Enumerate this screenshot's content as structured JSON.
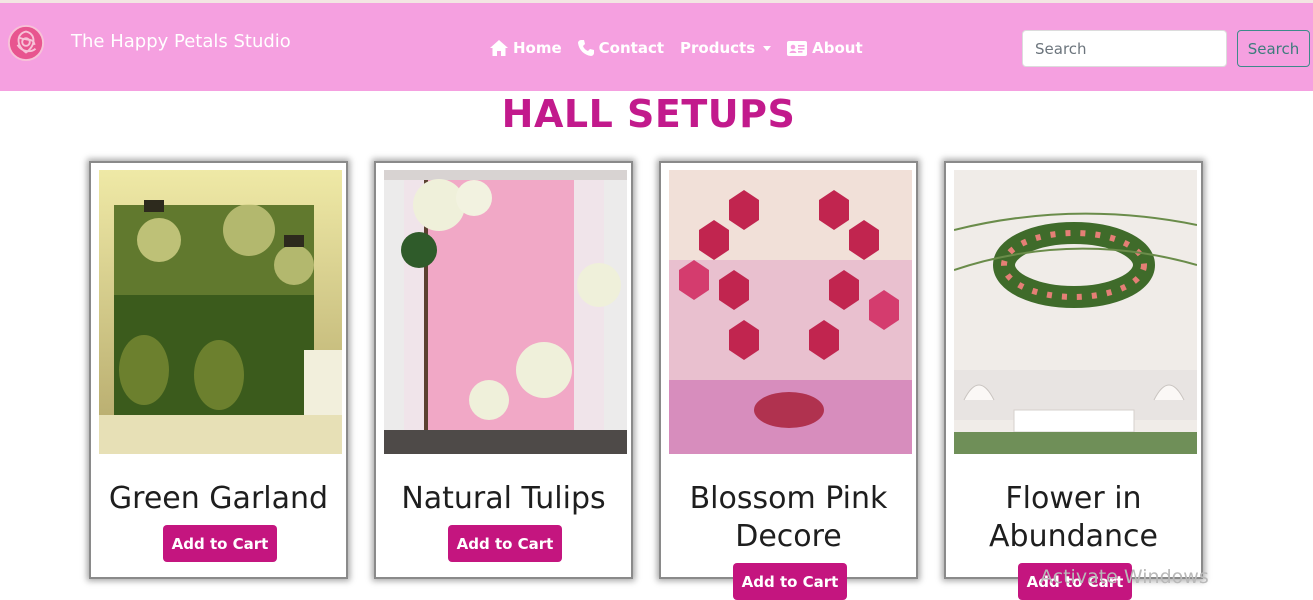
{
  "brand": {
    "name": "The Happy Petals Studio"
  },
  "nav": {
    "home": "Home",
    "contact": "Contact",
    "products": "Products",
    "about": "About"
  },
  "search": {
    "placeholder": "Search",
    "button": "Search"
  },
  "page": {
    "title": "HALL SETUPS"
  },
  "products": [
    {
      "name": "Green Garland",
      "button": "Add to Cart"
    },
    {
      "name": "Natural Tulips",
      "button": "Add to Cart"
    },
    {
      "name": "Blossom Pink Decore",
      "button": "Add to Cart"
    },
    {
      "name": "Flower in Abundance",
      "button": "Add to Cart"
    }
  ],
  "watermark": "Activate Windows",
  "colors": {
    "navbar": "#f5a0e0",
    "accent": "#c21a8c",
    "button": "#c4157f"
  }
}
